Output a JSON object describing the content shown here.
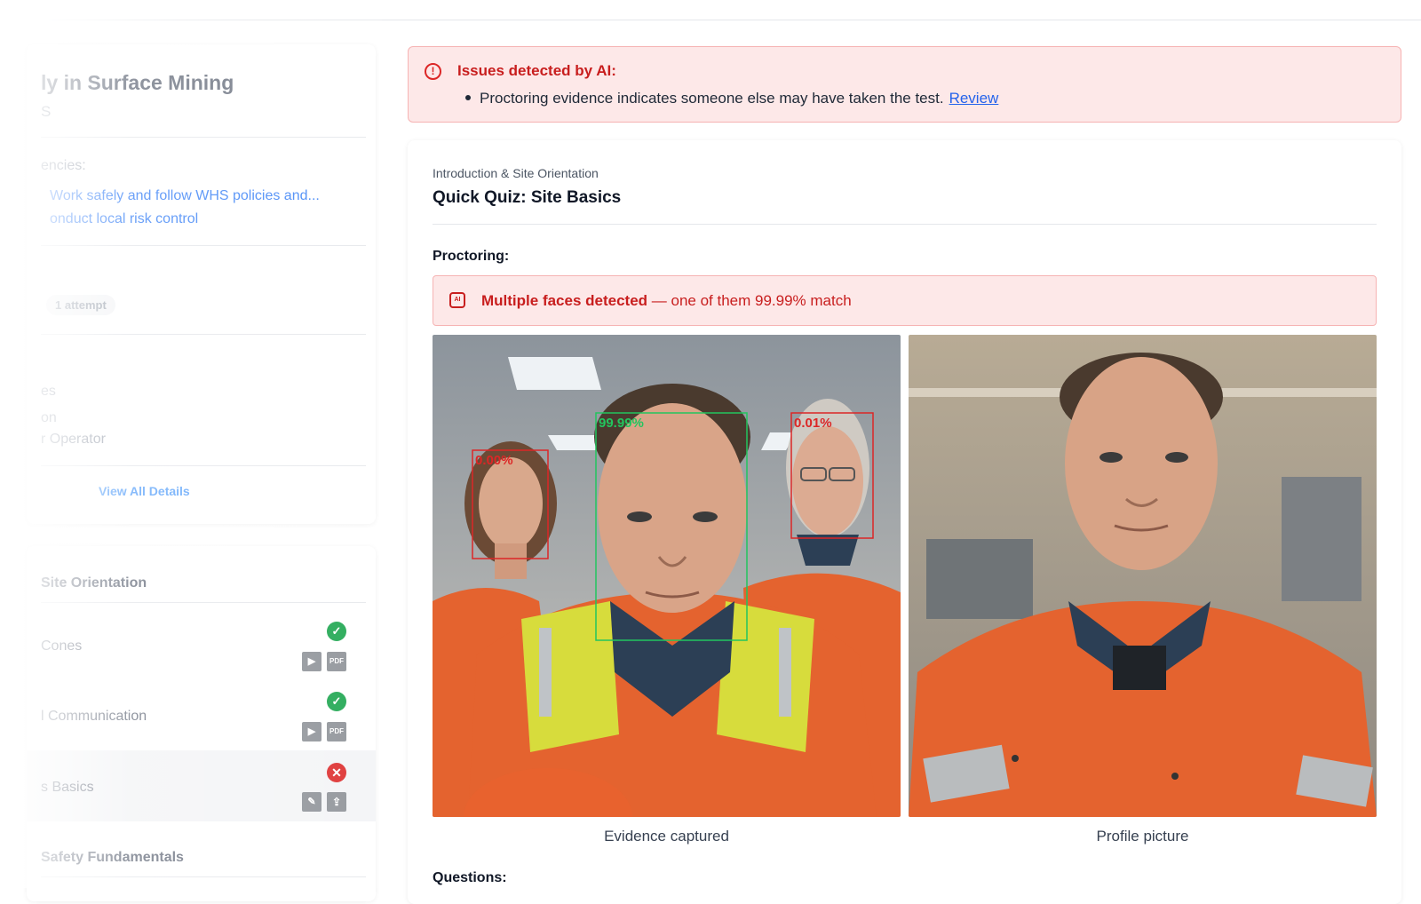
{
  "sidebar": {
    "course_title": "ly in Surface Mining",
    "course_sub": "S",
    "competencies_label": "encies:",
    "competencies": [
      "Work safely and follow WHS policies and...",
      "onduct local risk control"
    ],
    "attempts": "1 attempt",
    "meta": [
      "es",
      "on",
      "r Operator"
    ],
    "view_all": "View All Details",
    "sections": [
      {
        "title": "Site Orientation",
        "lessons": [
          {
            "label": "Cones",
            "status": "complete",
            "icons": [
              "play-icon",
              "pdf-icon"
            ]
          },
          {
            "label": "l Communication",
            "status": "complete",
            "icons": [
              "play-icon",
              "pdf-icon"
            ]
          },
          {
            "label": "s Basics",
            "status": "failed",
            "icons": [
              "edit-icon",
              "upload-icon"
            ]
          }
        ]
      },
      {
        "title": "Safety Fundamentals",
        "lessons": []
      }
    ]
  },
  "ai_alert": {
    "title": "Issues detected by AI:",
    "item": "Proctoring evidence indicates someone else may have taken the test.",
    "review_label": "Review"
  },
  "quiz": {
    "breadcrumb": "Introduction & Site Orientation",
    "title": "Quick Quiz: Site Basics",
    "proctoring_label": "Proctoring:",
    "face_alert_bold": "Multiple faces detected",
    "face_alert_rest": " — one of them 99.99% match",
    "faces": [
      {
        "label": "99.99%",
        "status": "match",
        "color": "#22c55e"
      },
      {
        "label": "0.00%",
        "status": "no-match",
        "color": "#dc2626"
      },
      {
        "label": "0.01%",
        "status": "no-match",
        "color": "#dc2626"
      }
    ],
    "evidence_caption": "Evidence captured",
    "profile_caption": "Profile picture",
    "questions_label": "Questions:"
  },
  "colors": {
    "danger": "#c81e1e",
    "danger_bg": "#fde8e8",
    "success": "#16a34a",
    "link": "#2563eb",
    "hi_vis_orange": "#e8622e",
    "hi_vis_yellow": "#d7dc3c"
  }
}
